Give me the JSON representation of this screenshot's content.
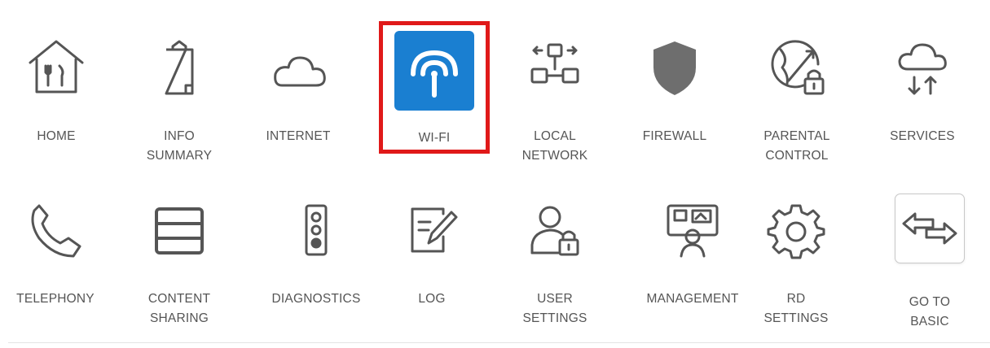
{
  "menu": {
    "row1": [
      {
        "label": "HOME",
        "icon": "home-icon"
      },
      {
        "label": "INFO\nSUMMARY",
        "icon": "clipboard-icon"
      },
      {
        "label": "INTERNET",
        "icon": "cloud-icon"
      },
      {
        "label": "WI-FI",
        "icon": "wifi-icon",
        "selected": true
      },
      {
        "label": "LOCAL\nNETWORK",
        "icon": "network-icon"
      },
      {
        "label": "FIREWALL",
        "icon": "shield-icon"
      },
      {
        "label": "PARENTAL\nCONTROL",
        "icon": "globe-lock-icon"
      },
      {
        "label": "SERVICES",
        "icon": "cloud-transfer-icon"
      }
    ],
    "row2": [
      {
        "label": "TELEPHONY",
        "icon": "phone-icon"
      },
      {
        "label": "CONTENT\nSHARING",
        "icon": "storage-icon"
      },
      {
        "label": "DIAGNOSTICS",
        "icon": "traffic-light-icon"
      },
      {
        "label": "LOG",
        "icon": "edit-log-icon"
      },
      {
        "label": "USER\nSETTINGS",
        "icon": "user-lock-icon"
      },
      {
        "label": "MANAGEMENT",
        "icon": "management-icon"
      },
      {
        "label": "RD\nSETTINGS",
        "icon": "gear-icon"
      },
      {
        "label": "GO TO\nBASIC",
        "icon": "swap-arrows-icon"
      }
    ]
  },
  "colors": {
    "accent": "#1a7fd1",
    "highlight": "#e01919",
    "icon_gray": "#555555",
    "shield": "#6e6e6e"
  }
}
